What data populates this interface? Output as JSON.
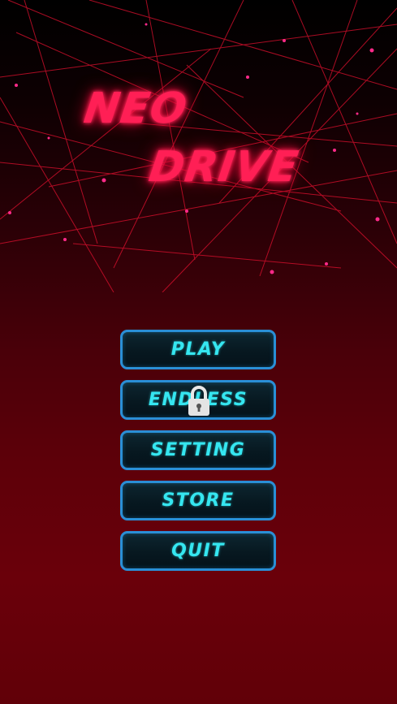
{
  "title": {
    "line1": "NEO",
    "line2": "DRIVE"
  },
  "menu": {
    "items": [
      {
        "label": "PLAY",
        "locked": false
      },
      {
        "label": "ENDLESS",
        "locked": true
      },
      {
        "label": "SETTING",
        "locked": false
      },
      {
        "label": "STORE",
        "locked": false
      },
      {
        "label": "QUIT",
        "locked": false
      }
    ]
  },
  "icons": {
    "lock": "lock-icon"
  },
  "colors": {
    "title": "#ff1f55",
    "button_text": "#35e6f0",
    "button_border": "#2a8fd6",
    "laser": "#e0102f",
    "background_bottom": "#6a000a"
  }
}
